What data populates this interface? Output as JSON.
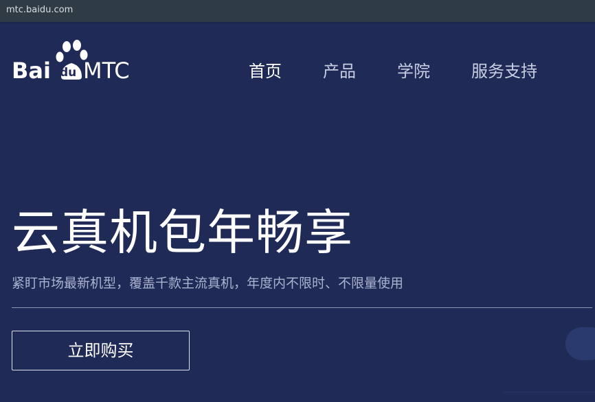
{
  "browser": {
    "url": "mtc.baidu.com"
  },
  "header": {
    "logo": {
      "brand": "Baidu",
      "brand_part1": "Bai",
      "brand_part2": "du",
      "product": "MTC"
    },
    "nav": [
      {
        "label": "首页",
        "active": true
      },
      {
        "label": "产品",
        "active": false
      },
      {
        "label": "学院",
        "active": false
      },
      {
        "label": "服务支持",
        "active": false
      }
    ]
  },
  "hero": {
    "title": "云真机包年畅享",
    "subtitle": "紧盯市场最新机型，覆盖千款主流真机，年度内不限时、不限量使用",
    "cta_label": "立即购买"
  },
  "colors": {
    "background": "#1f2a57",
    "urlbar": "#2f3c45",
    "text_primary": "#ffffff",
    "text_secondary": "#aab3cf"
  }
}
